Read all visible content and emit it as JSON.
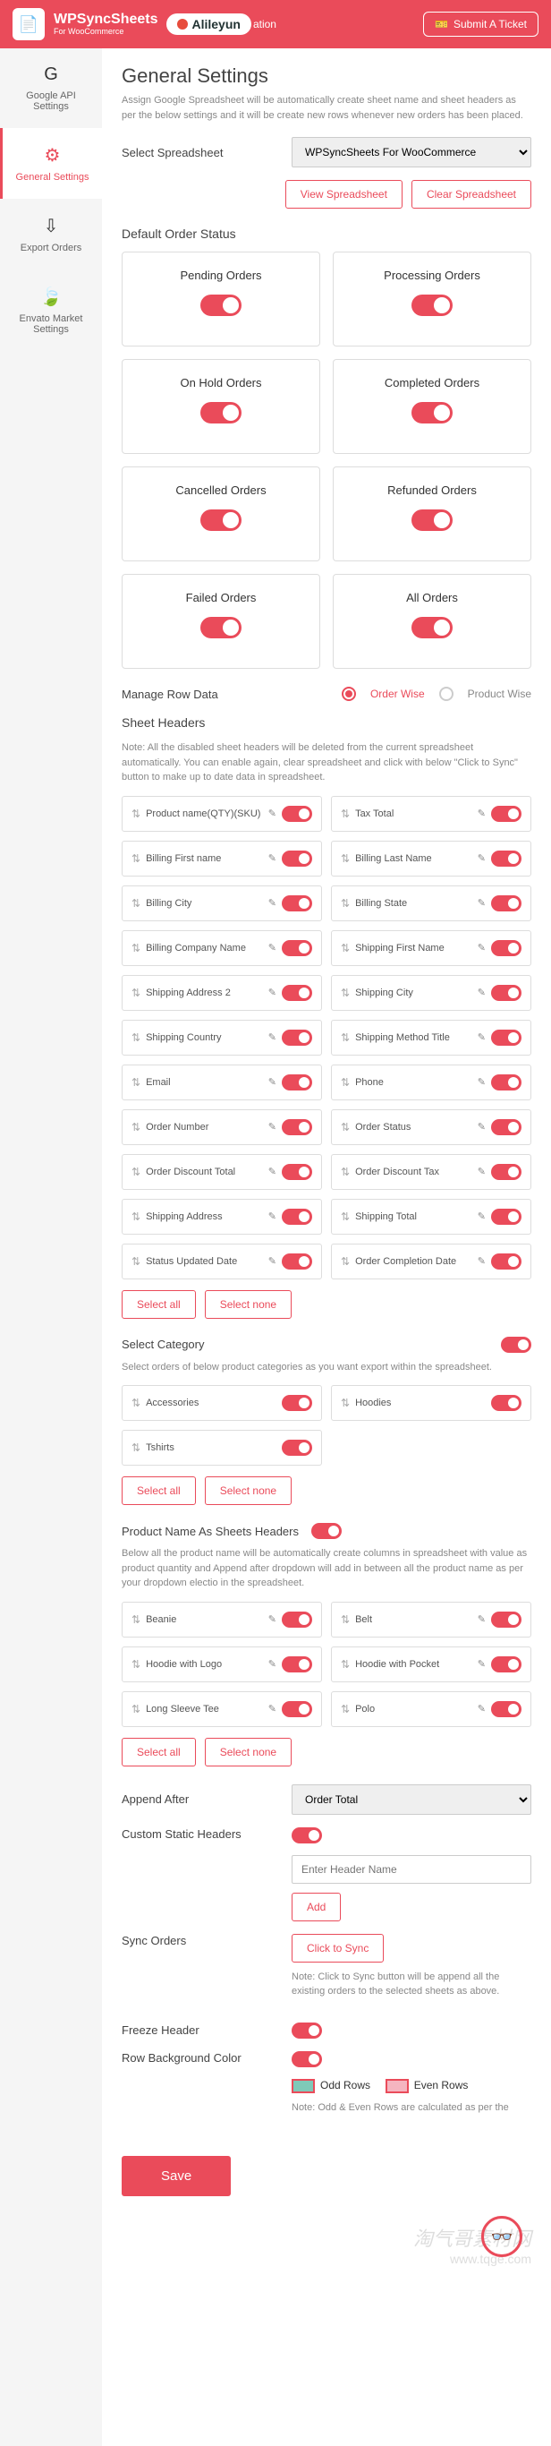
{
  "topbar": {
    "brand": "WPSyncSheets",
    "brand_sub": "For WooCommerce",
    "ali": "Alileyun",
    "ation": "ation",
    "ticket": "Submit A Ticket"
  },
  "sidebar": {
    "items": [
      {
        "label": "Google API Settings"
      },
      {
        "label": "General Settings"
      },
      {
        "label": "Export Orders"
      },
      {
        "label": "Envato Market Settings"
      }
    ]
  },
  "page": {
    "title": "General Settings",
    "desc": "Assign Google Spreadsheet will be automatically create sheet name and sheet headers as per the below settings and it will be create new rows whenever new orders has been placed.",
    "spreadsheet_label": "Select Spreadsheet",
    "spreadsheet_value": "WPSyncSheets For WooCommerce",
    "view_btn": "View Spreadsheet",
    "clear_btn": "Clear Spreadsheet",
    "status_title": "Default Order Status",
    "statuses": [
      "Pending Orders",
      "Processing Orders",
      "On Hold Orders",
      "Completed Orders",
      "Cancelled Orders",
      "Refunded Orders",
      "Failed Orders",
      "All Orders"
    ],
    "manage_row": "Manage Row Data",
    "order_wise": "Order Wise",
    "product_wise": "Product Wise",
    "sheet_headers": "Sheet Headers",
    "headers_note": "Note: All the disabled sheet headers will be deleted from the current spreadsheet automatically. You can enable again, clear spreadsheet and click with below \"Click to Sync\" button to make up to date data in spreadsheet.",
    "headers": [
      "Product name(QTY)(SKU)",
      "Tax Total",
      "Billing First name",
      "Billing Last Name",
      "Billing City",
      "Billing State",
      "Billing Company Name",
      "Shipping First Name",
      "Shipping Address 2",
      "Shipping City",
      "Shipping Country",
      "Shipping Method Title",
      "Email",
      "Phone",
      "Order Number",
      "Order Status",
      "Order Discount Total",
      "Order Discount Tax",
      "Shipping Address",
      "Shipping Total",
      "Status Updated Date",
      "Order Completion Date"
    ],
    "select_all": "Select all",
    "select_none": "Select none",
    "sel_cat": "Select Category",
    "sel_cat_desc": "Select orders of below product categories as you want export within the spreadsheet.",
    "categories": [
      "Accessories",
      "Hoodies",
      "Tshirts"
    ],
    "prod_name_headers": "Product Name As Sheets Headers",
    "prod_name_desc": "Below all the product name will be automatically create columns in spreadsheet with value as product quantity and Append after dropdown will add in between all the product name as per your dropdown electio in the spreadsheet.",
    "products": [
      "Beanie",
      "Belt",
      "Hoodie with Logo",
      "Hoodie with Pocket",
      "Long Sleeve Tee",
      "Polo"
    ],
    "append_after": "Append After",
    "append_value": "Order Total",
    "custom_headers": "Custom Static Headers",
    "header_placeholder": "Enter Header Name",
    "add_btn": "Add",
    "sync_orders": "Sync Orders",
    "sync_btn": "Click to Sync",
    "sync_note": "Note: Click to Sync button will be append all the existing orders to the selected sheets as above.",
    "freeze": "Freeze Header",
    "row_bg": "Row Background Color",
    "odd": "Odd Rows",
    "even": "Even Rows",
    "bg_note": "Note: Odd & Even Rows are calculated as per the",
    "save": "Save",
    "wm1": "淘气哥素材网",
    "wm2": "www.tqge.com"
  }
}
